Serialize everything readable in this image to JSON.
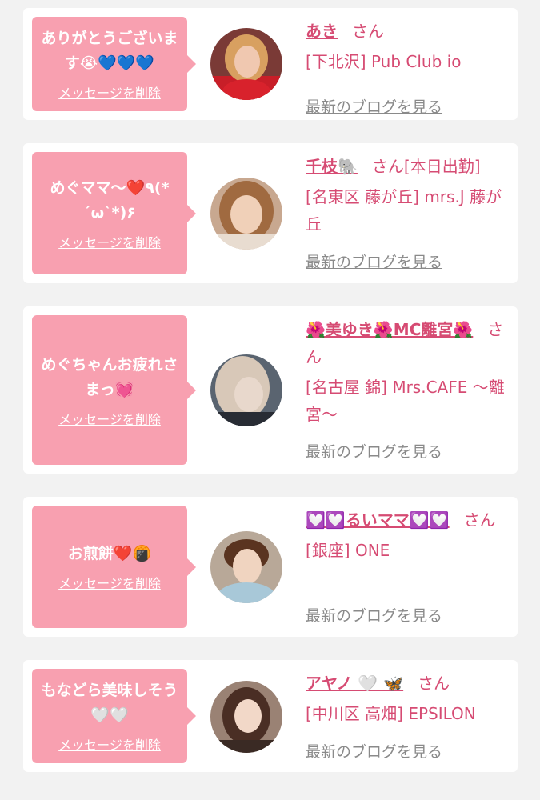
{
  "items": [
    {
      "message": "ありがとうございます😭💙💙💙",
      "delete_label": "メッセージを削除",
      "name": "あき",
      "honorific": "さん",
      "shop": "[下北沢] Pub Club io",
      "blog_label": "最新のブログを見る"
    },
    {
      "message": "めぐママ〜❤️٩(* ´ω`*)۶",
      "delete_label": "メッセージを削除",
      "name": "千枝🐘",
      "honorific": "さん[本日出勤]",
      "shop": "[名東区 藤が丘] mrs.J 藤が丘",
      "blog_label": "最新のブログを見る"
    },
    {
      "message": "めぐちゃんお疲れさまっ💓",
      "delete_label": "メッセージを削除",
      "name": "🌺美ゆき🌺MC離宮🌺",
      "honorific": "さん",
      "shop": "[名古屋 錦] Mrs.CAFE 〜離宮〜",
      "blog_label": "最新のブログを見る"
    },
    {
      "message": "お煎餅❤️🍘",
      "delete_label": "メッセージを削除",
      "name": "💟💟るいママ💟💟",
      "honorific": "さん",
      "shop": "[銀座] ONE",
      "blog_label": "最新のブログを見る"
    },
    {
      "message": "もなどら美味しそう🤍🤍",
      "delete_label": "メッセージを削除",
      "name": "アヤノ 🤍 🦋",
      "honorific": "さん",
      "shop": "[中川区 高畑] EPSILON",
      "blog_label": "最新のブログを見る"
    }
  ],
  "colors": {
    "page_background": "#f2f2f2",
    "card_background": "#ffffff",
    "bubble_pink": "#f8a0b0",
    "name_pink": "#d64b73",
    "link_gray": "#8a8a8a"
  },
  "icons": {
    "avatar": "profile-photo-icon"
  }
}
